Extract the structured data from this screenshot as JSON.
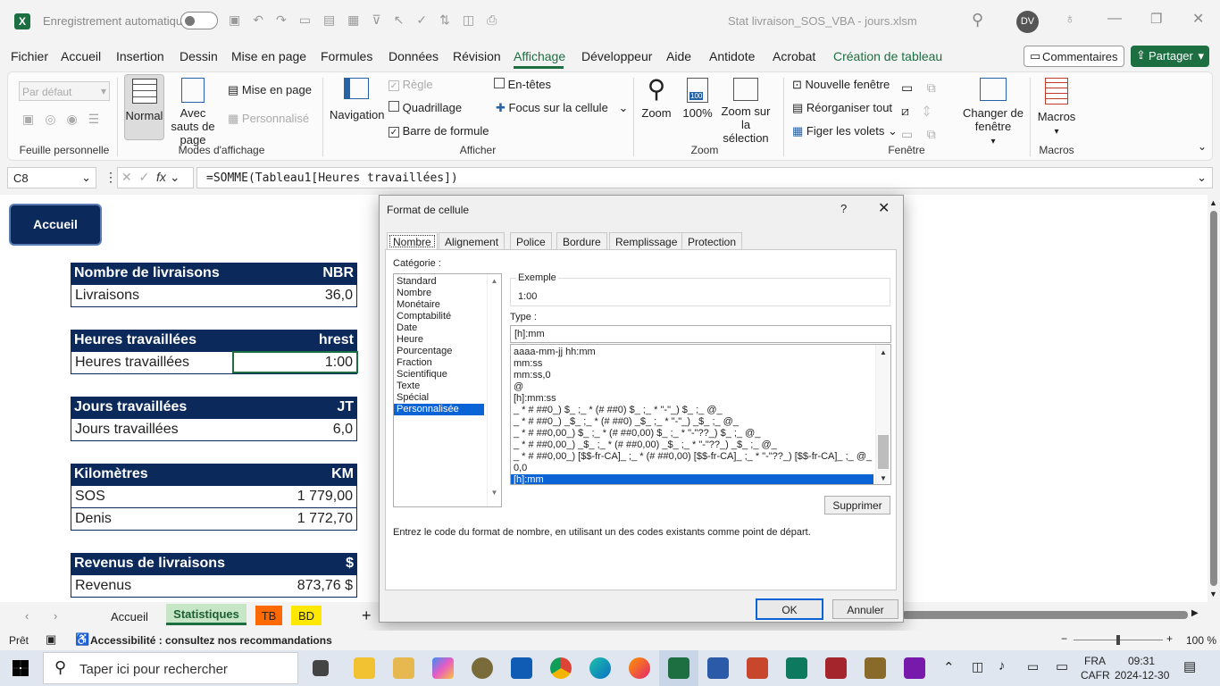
{
  "titlebar": {
    "autosave_label": "Enregistrement automatique",
    "doc_title": "Stat livraison_SOS_VBA - jours.xlsm",
    "avatar": "DV"
  },
  "menu": [
    "Fichier",
    "Accueil",
    "Insertion",
    "Dessin",
    "Mise en page",
    "Formules",
    "Données",
    "Révision",
    "Affichage",
    "Développeur",
    "Aide",
    "Antidote",
    "Acrobat",
    "Création de tableau"
  ],
  "menu_active": "Affichage",
  "menu_right": {
    "comments": "Commentaires",
    "share": "Partager"
  },
  "ribbon": {
    "sheetview_select": "Par défaut",
    "group_feuille": "Feuille personnelle",
    "normal": "Normal",
    "avec_sauts": "Avec sauts de page",
    "mise_en_page": "Mise en page",
    "personnalise": "Personnalisé",
    "group_modes": "Modes d'affichage",
    "navigation": "Navigation",
    "regle": "Règle",
    "quadrillage": "Quadrillage",
    "barre_formule": "Barre de formule",
    "en_tetes": "En-têtes",
    "focus": "Focus sur la cellule",
    "group_afficher": "Afficher",
    "zoom": "Zoom",
    "zoom100": "100%",
    "zoom_sel": "Zoom sur la sélection",
    "group_zoom": "Zoom",
    "nouvelle_fenetre": "Nouvelle fenêtre",
    "reorganiser": "Réorganiser tout",
    "figer": "Figer les volets",
    "changer_fenetre": "Changer de fenêtre",
    "group_fenetre": "Fenêtre",
    "macros": "Macros",
    "group_macros": "Macros"
  },
  "formulabar": {
    "namebox": "C8",
    "formula": "=SOMME(Tableau1[Heures travaillées])"
  },
  "sheet": {
    "accueil_button": "Accueil",
    "tables": [
      {
        "header": "Nombre de livraisons",
        "unit": "NBR",
        "rows": [
          {
            "label": "Livraisons",
            "value": "36,0"
          }
        ]
      },
      {
        "header": "Heures travaillées",
        "unit": "hrest",
        "rows": [
          {
            "label": "Heures travaillées",
            "value": "1:00"
          }
        ]
      },
      {
        "header": "Jours travaillées",
        "unit": "JT",
        "rows": [
          {
            "label": "Jours travaillées",
            "value": "6,0"
          }
        ]
      },
      {
        "header": "Kilomètres",
        "unit": "KM",
        "rows": [
          {
            "label": "SOS",
            "value": "1 779,00"
          },
          {
            "label": "Denis",
            "value": "1 772,70"
          }
        ]
      },
      {
        "header": "Revenus de livraisons",
        "unit": "$",
        "rows": [
          {
            "label": "Revenus",
            "value": "873,76  $"
          }
        ]
      }
    ]
  },
  "dialog": {
    "title": "Format de cellule",
    "help": "?",
    "tabs": [
      "Nombre",
      "Alignement",
      "Police",
      "Bordure",
      "Remplissage",
      "Protection"
    ],
    "category_label": "Catégorie :",
    "categories": [
      "Standard",
      "Nombre",
      "Monétaire",
      "Comptabilité",
      "Date",
      "Heure",
      "Pourcentage",
      "Fraction",
      "Scientifique",
      "Texte",
      "Spécial",
      "Personnalisée"
    ],
    "selected_category": "Personnalisée",
    "exemple_label": "Exemple",
    "exemple_value": "1:00",
    "type_label": "Type :",
    "type_value": "[h]:mm",
    "formats": [
      "aaaa-mm-jj hh:mm",
      "mm:ss",
      "mm:ss,0",
      "@",
      "[h]:mm:ss",
      "_ * # ##0_) $_ ;_ * (# ##0) $_ ;_ * \"-\"_) $_ ;_ @_",
      "_ * # ##0_) _$_ ;_ * (# ##0) _$_ ;_ * \"-\"_) _$_ ;_ @_",
      "_ * # ##0,00_) $_ ;_ * (# ##0,00) $_ ;_ * \"-\"??_) $_ ;_ @_",
      "_ * # ##0,00_) _$_ ;_ * (# ##0,00) _$_ ;_ * \"-\"??_) _$_ ;_ @_",
      "_ * # ##0,00_) [$$-fr-CA]_ ;_ * (# ##0,00) [$$-fr-CA]_ ;_ * \"-\"??_) [$$-fr-CA]_ ;_ @_",
      "0,0",
      "[h]:mm"
    ],
    "selected_format": "[h]:mm",
    "delete_button": "Supprimer",
    "hint": "Entrez le code du format de nombre, en utilisant un des codes existants comme point de départ.",
    "ok": "OK",
    "cancel": "Annuler"
  },
  "sheettabs": [
    "Accueil",
    "Statistiques",
    "TB",
    "BD"
  ],
  "sheettab_active": "Statistiques",
  "statusbar": {
    "ready": "Prêt",
    "accessibility": "Accessibilité : consultez nos recommandations",
    "zoom": "100 %"
  },
  "taskbar": {
    "search": "Taper ici pour rechercher",
    "lang1": "FRA",
    "lang2": "CAFR",
    "time": "09:31",
    "date": "2024-12-30"
  },
  "colors": {
    "header_navy": "#0b2a5b",
    "excel_green": "#1d6f42",
    "tb_orange": "#ff6a00",
    "bd_yellow": "#ffe800",
    "select_blue": "#0a64d6"
  }
}
